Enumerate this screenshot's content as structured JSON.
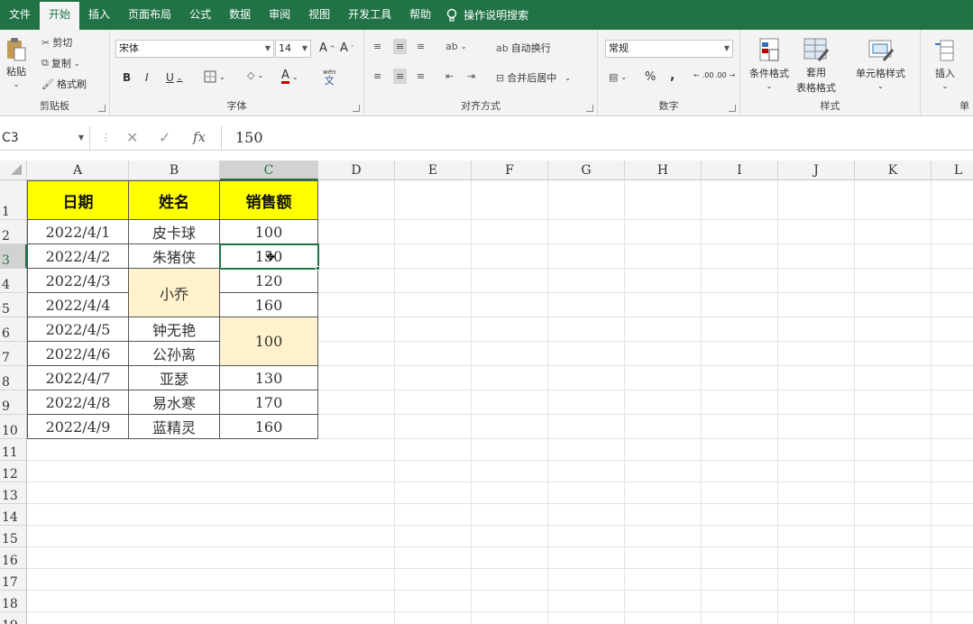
{
  "tabs": {
    "file": "文件",
    "home": "开始",
    "insert": "插入",
    "layout": "页面布局",
    "formulas": "公式",
    "data": "数据",
    "review": "审阅",
    "view": "视图",
    "developer": "开发工具",
    "help": "帮助",
    "tell_me": "操作说明搜索"
  },
  "ribbon": {
    "clipboard": {
      "paste": "粘贴",
      "cut": "剪切",
      "copy": "复制",
      "format_painter": "格式刷",
      "label": "剪贴板"
    },
    "font": {
      "name": "宋体",
      "size": "14",
      "bold": "B",
      "italic": "I",
      "underline": "U",
      "grow": "A",
      "shrink": "A",
      "font_color": "A",
      "phonetic": "文",
      "phonetic_top": "wén",
      "label": "字体"
    },
    "alignment": {
      "wrap": "自动换行",
      "merge": "合并后居中",
      "label": "对齐方式"
    },
    "number": {
      "format": "常规",
      "percent": "%",
      "comma": ",",
      "inc": ".00",
      "dec": ".00",
      "label": "数字"
    },
    "styles": {
      "conditional": "条件格式",
      "table_a": "套用",
      "table_b": "表格格式",
      "cell_styles": "单元格样式",
      "label": "样式"
    },
    "cells": {
      "insert": "插入",
      "label": "单"
    }
  },
  "formula_bar": {
    "name_box": "C3",
    "fx": "fx",
    "value": "150"
  },
  "columns": [
    "A",
    "B",
    "C",
    "D",
    "E",
    "F",
    "G",
    "H",
    "I",
    "J",
    "K",
    "L"
  ],
  "rows": [
    "1",
    "2",
    "3",
    "4",
    "5",
    "6",
    "7",
    "8",
    "9",
    "10",
    "11",
    "12",
    "13",
    "14",
    "15",
    "16",
    "17",
    "18",
    "19"
  ],
  "table": {
    "headers": [
      "日期",
      "姓名",
      "销售额"
    ],
    "dates": [
      "2022/4/1",
      "2022/4/2",
      "2022/4/3",
      "2022/4/4",
      "2022/4/5",
      "2022/4/6",
      "2022/4/7",
      "2022/4/8",
      "2022/4/9"
    ],
    "names": {
      "r2": "皮卡球",
      "r3": "朱猪侠",
      "r45": "小乔",
      "r6": "钟无艳",
      "r7": "公孙离",
      "r8": "亚瑟",
      "r9": "易水寒",
      "r10": "蓝精灵"
    },
    "sales": {
      "r2": "100",
      "r3": "150",
      "r4": "120",
      "r5": "160",
      "r67": "100",
      "r8": "130",
      "r9": "170",
      "r10": "160"
    }
  },
  "colors": {
    "accent": "#217346",
    "header_fill": "#ffff00",
    "merged_fill": "#fff2cc"
  }
}
